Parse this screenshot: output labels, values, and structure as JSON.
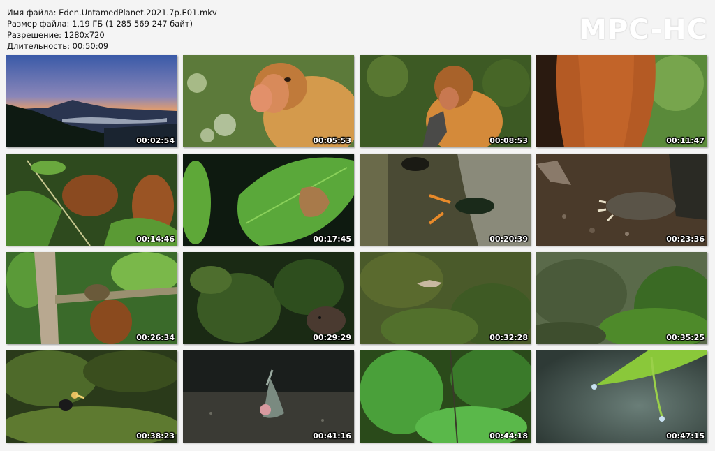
{
  "info": {
    "filename": "Имя файла: Eden.UntamedPlanet.2021.7p.E01.mkv",
    "filesize": "Размер файла: 1,19 ГБ (1 285 569 247 байт)",
    "resolution": "Разрешение: 1280x720",
    "duration": "Длительность: 00:50:09"
  },
  "logo": "MPC-HC",
  "thumbnails": [
    {
      "time": "00:02:54",
      "scene": "mountain-sunset"
    },
    {
      "time": "00:05:53",
      "scene": "proboscis-monkey-closeup"
    },
    {
      "time": "00:08:53",
      "scene": "proboscis-monkey-forest"
    },
    {
      "time": "00:11:47",
      "scene": "orange-fur"
    },
    {
      "time": "00:14:46",
      "scene": "orangutan-foliage"
    },
    {
      "time": "00:17:45",
      "scene": "leaf-closeup"
    },
    {
      "time": "00:20:39",
      "scene": "insects-on-bark"
    },
    {
      "time": "00:23:36",
      "scene": "animal-paw-soil"
    },
    {
      "time": "00:26:34",
      "scene": "branch-grip"
    },
    {
      "time": "00:29:29",
      "scene": "moss-rodent"
    },
    {
      "time": "00:32:28",
      "scene": "flying-squirrel-canopy"
    },
    {
      "time": "00:35:25",
      "scene": "forest-canopy"
    },
    {
      "time": "00:38:23",
      "scene": "hornbill-foliage"
    },
    {
      "time": "00:41:16",
      "scene": "water-splash"
    },
    {
      "time": "00:44:18",
      "scene": "rainforest-trees"
    },
    {
      "time": "00:47:15",
      "scene": "leaf-water-drop"
    }
  ]
}
